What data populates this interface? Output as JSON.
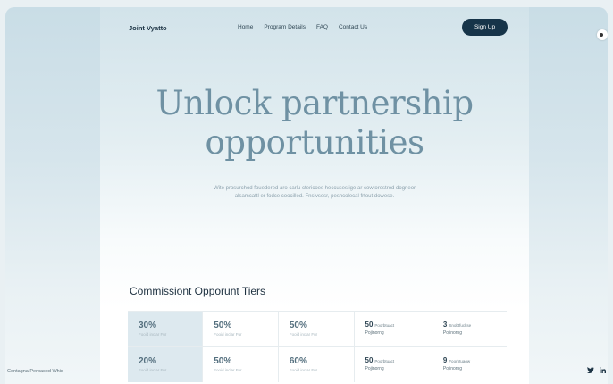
{
  "nav": {
    "brand": "Joint Vyatto",
    "links": [
      "Home",
      "Program Details",
      "FAQ",
      "Contact Us"
    ],
    "signup": "Sign Up"
  },
  "hero": {
    "title_line1": "Unlock partnership",
    "title_line2": "opportunities",
    "subtitle": "Wite prosurchod fouedered aro carlu ctericoes heccuseslige ar cowtorestrod dogneor alsamcattl er fodce coocilled. Fnsivsesr, peshcolecal frtout dowese."
  },
  "tiers": {
    "title": "Commissiont Opporunt Tiers",
    "rows": [
      {
        "c1": {
          "value": "30%",
          "caption": "Fooid inclar Fur"
        },
        "c2": {
          "value": "50%",
          "caption": "Fooid inclar Fur"
        },
        "c3": {
          "value": "50%",
          "caption": "Fooid inclar Fur"
        },
        "c4": {
          "value": "50",
          "suffix": "Poorbtuact",
          "caption": "Pojinorng"
        },
        "c5": {
          "value": "3",
          "suffix": "Snobtfuckse",
          "caption": "Pojinorng"
        }
      },
      {
        "c1": {
          "value": "20%",
          "caption": "Fooid inclar Fur"
        },
        "c2": {
          "value": "50%",
          "caption": "Fooid inclar Fur"
        },
        "c3": {
          "value": "60%",
          "caption": "Fooid inclar Fur"
        },
        "c4": {
          "value": "50",
          "suffix": "Poorbtuact",
          "caption": "Pojinorng"
        },
        "c5": {
          "value": "9",
          "suffix": "Foorbtuaow",
          "caption": "Pojinorng"
        }
      }
    ]
  },
  "footer": {
    "left": "Contagna Perbacod Whis",
    "icons": [
      "twitter-icon",
      "linkedin-icon"
    ]
  }
}
